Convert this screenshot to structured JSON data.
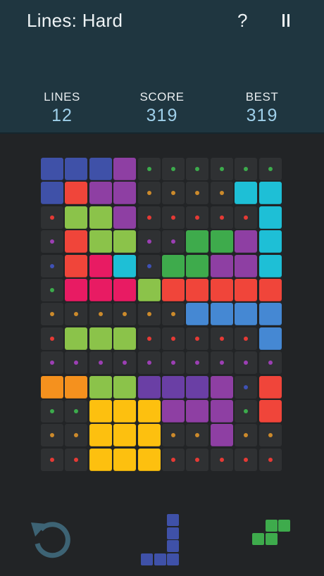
{
  "header": {
    "title": "Lines: Hard",
    "help_label": "?",
    "pause_icon": "pause-icon"
  },
  "stats": {
    "lines": {
      "label": "LINES",
      "value": "12"
    },
    "score": {
      "label": "SCORE",
      "value": "319"
    },
    "best": {
      "label": "BEST",
      "value": "319"
    }
  },
  "palette": {
    "n": "#3f51a8",
    "r": "#f0453a",
    "p": "#8e3fa3",
    "c": "#1ebfd6",
    "l": "#8bc34a",
    "g": "#3eab4c",
    "k": "#e81b63",
    "b": "#4588d3",
    "o": "#f5911e",
    "y": "#fdc00f",
    "v": "#6a3fa5",
    "dot_g": "#3cab4c",
    "dot_o": "#cc8a2b",
    "dot_r": "#e63a35",
    "dot_p": "#9c3fb4",
    "dot_n": "#3f51b5",
    "cell_bg": "#2f3133"
  },
  "board": {
    "rows": [
      [
        "n",
        "n",
        "n",
        "p",
        ".g",
        ".g",
        ".g",
        ".g",
        ".g",
        ".g"
      ],
      [
        "n",
        "r",
        "p",
        "p",
        ".o",
        ".o",
        ".o",
        ".o",
        "c",
        "c"
      ],
      [
        ".r",
        "l",
        "l",
        "p",
        ".r",
        ".r",
        ".r",
        ".r",
        ".r",
        "c"
      ],
      [
        ".p",
        "r",
        "l",
        "l",
        ".p",
        ".p",
        "g",
        "g",
        "p",
        "c"
      ],
      [
        ".n",
        "r",
        "k",
        "c",
        ".n",
        "g",
        "g",
        "p",
        "p",
        "c"
      ],
      [
        ".g",
        "k",
        "k",
        "k",
        "l",
        "r",
        "r",
        "r",
        "r",
        "r"
      ],
      [
        ".o",
        ".o",
        ".o",
        ".o",
        ".o",
        ".o",
        "b",
        "b",
        "b",
        "b"
      ],
      [
        ".r",
        "l",
        "l",
        "l",
        ".r",
        ".r",
        ".r",
        ".r",
        ".r",
        "b"
      ],
      [
        ".p",
        ".p",
        ".p",
        ".p",
        ".p",
        ".p",
        ".p",
        ".p",
        ".p",
        ".p"
      ],
      [
        "o",
        "o",
        "l",
        "l",
        "v",
        "v",
        "v",
        "p",
        ".n",
        "r"
      ],
      [
        ".g",
        ".g",
        "y",
        "y",
        "y",
        "p",
        "p",
        "p",
        ".g",
        "r"
      ],
      [
        ".o",
        ".o",
        "y",
        "y",
        "y",
        ".o",
        ".o",
        "p",
        ".o",
        ".o"
      ],
      [
        ".r",
        ".r",
        "y",
        "y",
        "y",
        ".r",
        ".r",
        ".r",
        ".r",
        ".r"
      ]
    ]
  },
  "controls": {
    "undo_icon": "undo-icon",
    "piece_a": {
      "color": "#3f51a8",
      "cells": [
        [
          2,
          0
        ],
        [
          2,
          1
        ],
        [
          2,
          2
        ],
        [
          0,
          3
        ],
        [
          1,
          3
        ],
        [
          2,
          3
        ]
      ]
    },
    "piece_b": {
      "color": "#3eab4c",
      "cells": [
        [
          1,
          0
        ],
        [
          2,
          0
        ],
        [
          0,
          1
        ],
        [
          1,
          1
        ]
      ]
    }
  }
}
